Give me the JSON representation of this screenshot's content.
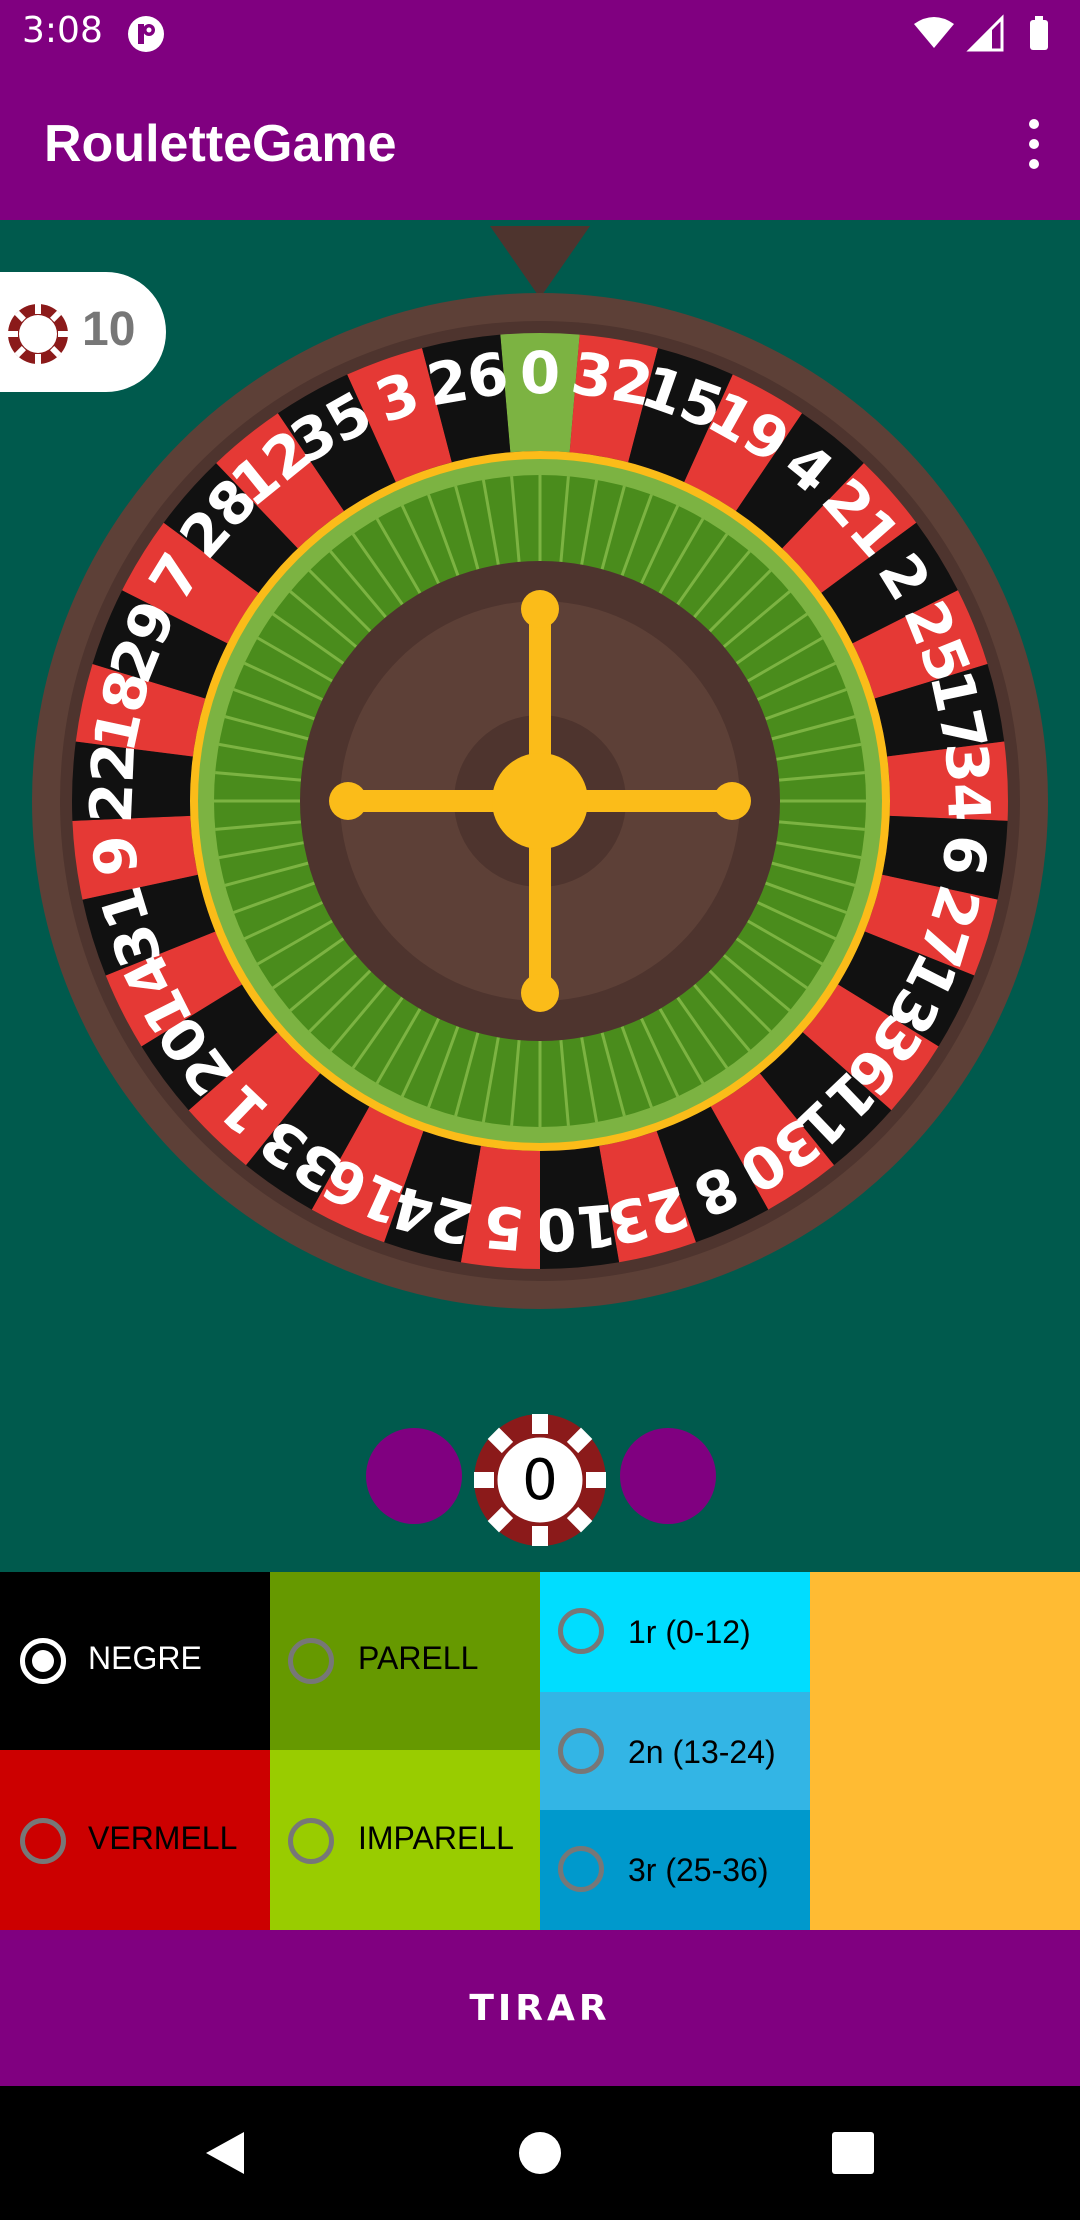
{
  "status_bar": {
    "time": "3:08"
  },
  "app_bar": {
    "title": "RouletteGame"
  },
  "game": {
    "coins": "10",
    "chip_value": "0",
    "wheel_numbers": [
      "0",
      "32",
      "15",
      "19",
      "4",
      "21",
      "2",
      "25",
      "17",
      "34",
      "6",
      "27",
      "13",
      "36",
      "11",
      "30",
      "8",
      "23",
      "10",
      "5",
      "24",
      "16",
      "33",
      "1",
      "20",
      "14",
      "31",
      "9",
      "22",
      "18",
      "29",
      "7",
      "28",
      "12",
      "35",
      "3",
      "26"
    ]
  },
  "bets": {
    "negre": {
      "label": "NEGRE",
      "checked": true
    },
    "vermell": {
      "label": "VERMELL",
      "checked": false
    },
    "parell": {
      "label": "PARELL",
      "checked": false
    },
    "imparell": {
      "label": "IMPARELL",
      "checked": false
    },
    "dozen1": {
      "label": "1r (0-12)",
      "checked": false
    },
    "dozen2": {
      "label": "2n (13-24)",
      "checked": false
    },
    "dozen3": {
      "label": "3r (25-36)",
      "checked": false
    }
  },
  "action": {
    "spin_label": "TIRAR"
  },
  "colors": {
    "primary": "#800080",
    "table": "#005a4d",
    "black_pocket": "#111111",
    "red_pocket": "#e53935",
    "green_pocket": "#7cb342",
    "wheel_rim": "#5d4037",
    "turret": "#fbbc19",
    "negre_bg": "#000000",
    "vermell_bg": "#cc0000",
    "parell_bg": "#669900",
    "imparell_bg": "#99cc00",
    "dozen1_bg": "#00ddff",
    "dozen2_bg": "#33b5e5",
    "dozen3_bg": "#0099cc",
    "extra_bg": "#ffbb33"
  },
  "nav": {
    "back": "back-icon",
    "home": "home-icon",
    "recents": "recents-icon"
  }
}
